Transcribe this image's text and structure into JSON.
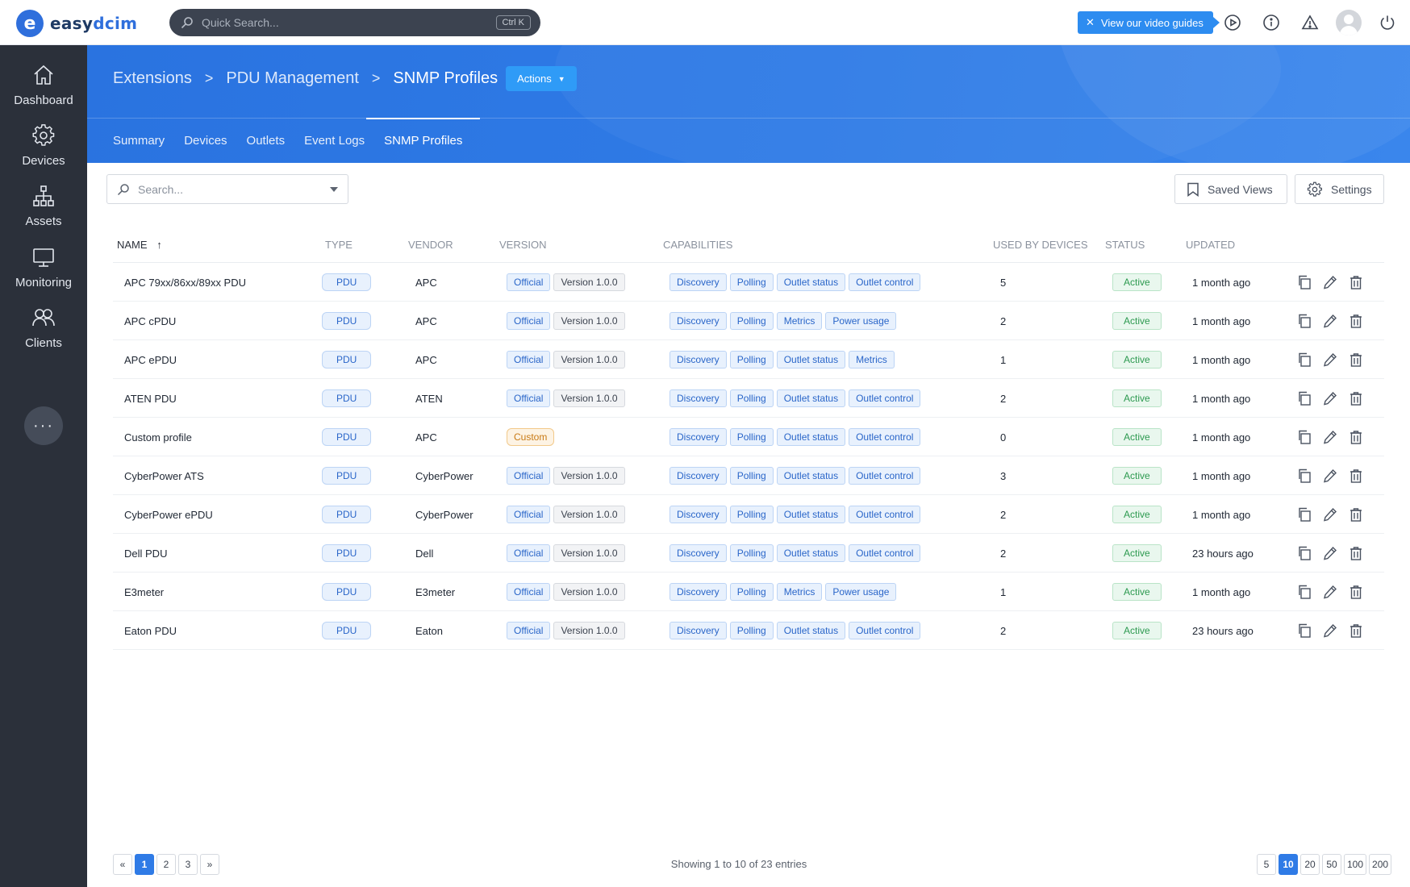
{
  "brand": {
    "logo_letter": "e",
    "name_part1": "easy",
    "name_part2": "dcim"
  },
  "topbar": {
    "search_placeholder": "Quick Search...",
    "search_shortcut": "Ctrl K",
    "video_guides_label": "View our video guides",
    "icons": [
      "play-circle-icon",
      "info-icon",
      "warning-icon",
      "user-avatar",
      "power-icon"
    ]
  },
  "sidebar": {
    "items": [
      {
        "label": "Dashboard",
        "icon": "home-icon"
      },
      {
        "label": "Devices",
        "icon": "gear-icon"
      },
      {
        "label": "Assets",
        "icon": "hierarchy-icon"
      },
      {
        "label": "Monitoring",
        "icon": "monitor-icon"
      },
      {
        "label": "Clients",
        "icon": "users-icon"
      }
    ],
    "more_label": "···"
  },
  "breadcrumb": {
    "items": [
      "Extensions",
      "PDU Management",
      "SNMP Profiles"
    ],
    "actions_label": "Actions"
  },
  "tabs": [
    {
      "label": "Summary",
      "active": false
    },
    {
      "label": "Devices",
      "active": false
    },
    {
      "label": "Outlets",
      "active": false
    },
    {
      "label": "Event Logs",
      "active": false
    },
    {
      "label": "SNMP Profiles",
      "active": true
    }
  ],
  "toolbar": {
    "search_placeholder": "Search...",
    "saved_views_label": "Saved Views",
    "settings_label": "Settings"
  },
  "table": {
    "columns": [
      "NAME",
      "TYPE",
      "VENDOR",
      "VERSION",
      "CAPABILITIES",
      "USED BY DEVICES",
      "STATUS",
      "UPDATED"
    ],
    "rows": [
      {
        "name": "APC 79xx/86xx/89xx PDU",
        "type": "PDU",
        "vendor": "APC",
        "version_kind": "Official",
        "version": "Version 1.0.0",
        "caps": [
          "Discovery",
          "Polling",
          "Outlet status",
          "Outlet control"
        ],
        "used": "5",
        "status": "Active",
        "updated": "1 month ago"
      },
      {
        "name": "APC cPDU",
        "type": "PDU",
        "vendor": "APC",
        "version_kind": "Official",
        "version": "Version 1.0.0",
        "caps": [
          "Discovery",
          "Polling",
          "Metrics",
          "Power usage"
        ],
        "used": "2",
        "status": "Active",
        "updated": "1 month ago"
      },
      {
        "name": "APC ePDU",
        "type": "PDU",
        "vendor": "APC",
        "version_kind": "Official",
        "version": "Version 1.0.0",
        "caps": [
          "Discovery",
          "Polling",
          "Outlet status",
          "Metrics"
        ],
        "used": "1",
        "status": "Active",
        "updated": "1 month ago"
      },
      {
        "name": "ATEN PDU",
        "type": "PDU",
        "vendor": "ATEN",
        "version_kind": "Official",
        "version": "Version 1.0.0",
        "caps": [
          "Discovery",
          "Polling",
          "Outlet status",
          "Outlet control"
        ],
        "used": "2",
        "status": "Active",
        "updated": "1 month ago"
      },
      {
        "name": "Custom profile",
        "type": "PDU",
        "vendor": "APC",
        "version_kind": "Custom",
        "version": "",
        "caps": [
          "Discovery",
          "Polling",
          "Outlet status",
          "Outlet control"
        ],
        "used": "0",
        "status": "Active",
        "updated": "1 month ago"
      },
      {
        "name": "CyberPower ATS",
        "type": "PDU",
        "vendor": "CyberPower",
        "version_kind": "Official",
        "version": "Version 1.0.0",
        "caps": [
          "Discovery",
          "Polling",
          "Outlet status",
          "Outlet control"
        ],
        "used": "3",
        "status": "Active",
        "updated": "1 month ago"
      },
      {
        "name": "CyberPower ePDU",
        "type": "PDU",
        "vendor": "CyberPower",
        "version_kind": "Official",
        "version": "Version 1.0.0",
        "caps": [
          "Discovery",
          "Polling",
          "Outlet status",
          "Outlet control"
        ],
        "used": "2",
        "status": "Active",
        "updated": "1 month ago"
      },
      {
        "name": "Dell PDU",
        "type": "PDU",
        "vendor": "Dell",
        "version_kind": "Official",
        "version": "Version 1.0.0",
        "caps": [
          "Discovery",
          "Polling",
          "Outlet status",
          "Outlet control"
        ],
        "used": "2",
        "status": "Active",
        "updated": "23 hours ago"
      },
      {
        "name": "E3meter",
        "type": "PDU",
        "vendor": "E3meter",
        "version_kind": "Official",
        "version": "Version 1.0.0",
        "caps": [
          "Discovery",
          "Polling",
          "Metrics",
          "Power usage"
        ],
        "used": "1",
        "status": "Active",
        "updated": "1 month ago"
      },
      {
        "name": "Eaton PDU",
        "type": "PDU",
        "vendor": "Eaton",
        "version_kind": "Official",
        "version": "Version 1.0.0",
        "caps": [
          "Discovery",
          "Polling",
          "Outlet status",
          "Outlet control"
        ],
        "used": "2",
        "status": "Active",
        "updated": "23 hours ago"
      }
    ],
    "row_action_icons": [
      "copy-icon",
      "edit-icon",
      "delete-icon"
    ]
  },
  "pagination": {
    "prev_label": "«",
    "next_label": "»",
    "pages": [
      "1",
      "2",
      "3"
    ],
    "current_page": "1",
    "showing_text": "Showing 1 to 10 of 23 entries",
    "page_sizes": [
      "5",
      "10",
      "20",
      "50",
      "100",
      "200"
    ],
    "current_page_size": "10"
  },
  "colors": {
    "accent": "#2f7be6",
    "sidebar_bg": "#2b303a",
    "status_active": "#2d9a50",
    "custom_badge": "#c97a15"
  }
}
